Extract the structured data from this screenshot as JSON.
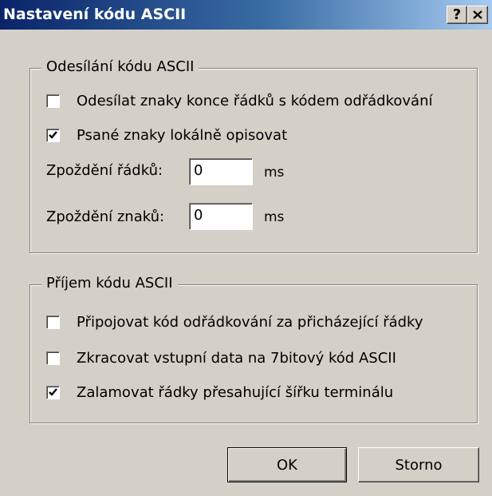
{
  "dialog": {
    "title": "Nastavení kódu ASCII",
    "help_label": "?",
    "close_label": "✕"
  },
  "send_group": {
    "legend": "Odesílání kódu ASCII",
    "checkboxes": [
      {
        "label": "Odesílat znaky konce řádků s kódem odřádkování",
        "checked": false
      },
      {
        "label": "Psané znaky lokálně opisovat",
        "checked": true
      }
    ],
    "line_delay": {
      "label": "Zpoždění řádků:",
      "value": "0",
      "unit": "ms"
    },
    "char_delay": {
      "label": "Zpoždění znaků:",
      "value": "0",
      "unit": "ms"
    }
  },
  "receive_group": {
    "legend": "Příjem kódu ASCII",
    "checkboxes": [
      {
        "label": "Připojovat kód odřádkování za přicházející řádky",
        "checked": false
      },
      {
        "label": "Zkracovat vstupní data na 7bitový kód ASCII",
        "checked": false
      },
      {
        "label": "Zalamovat řádky přesahující šířku terminálu",
        "checked": true
      }
    ]
  },
  "buttons": {
    "ok_label": "OK",
    "cancel_label": "Storno"
  }
}
